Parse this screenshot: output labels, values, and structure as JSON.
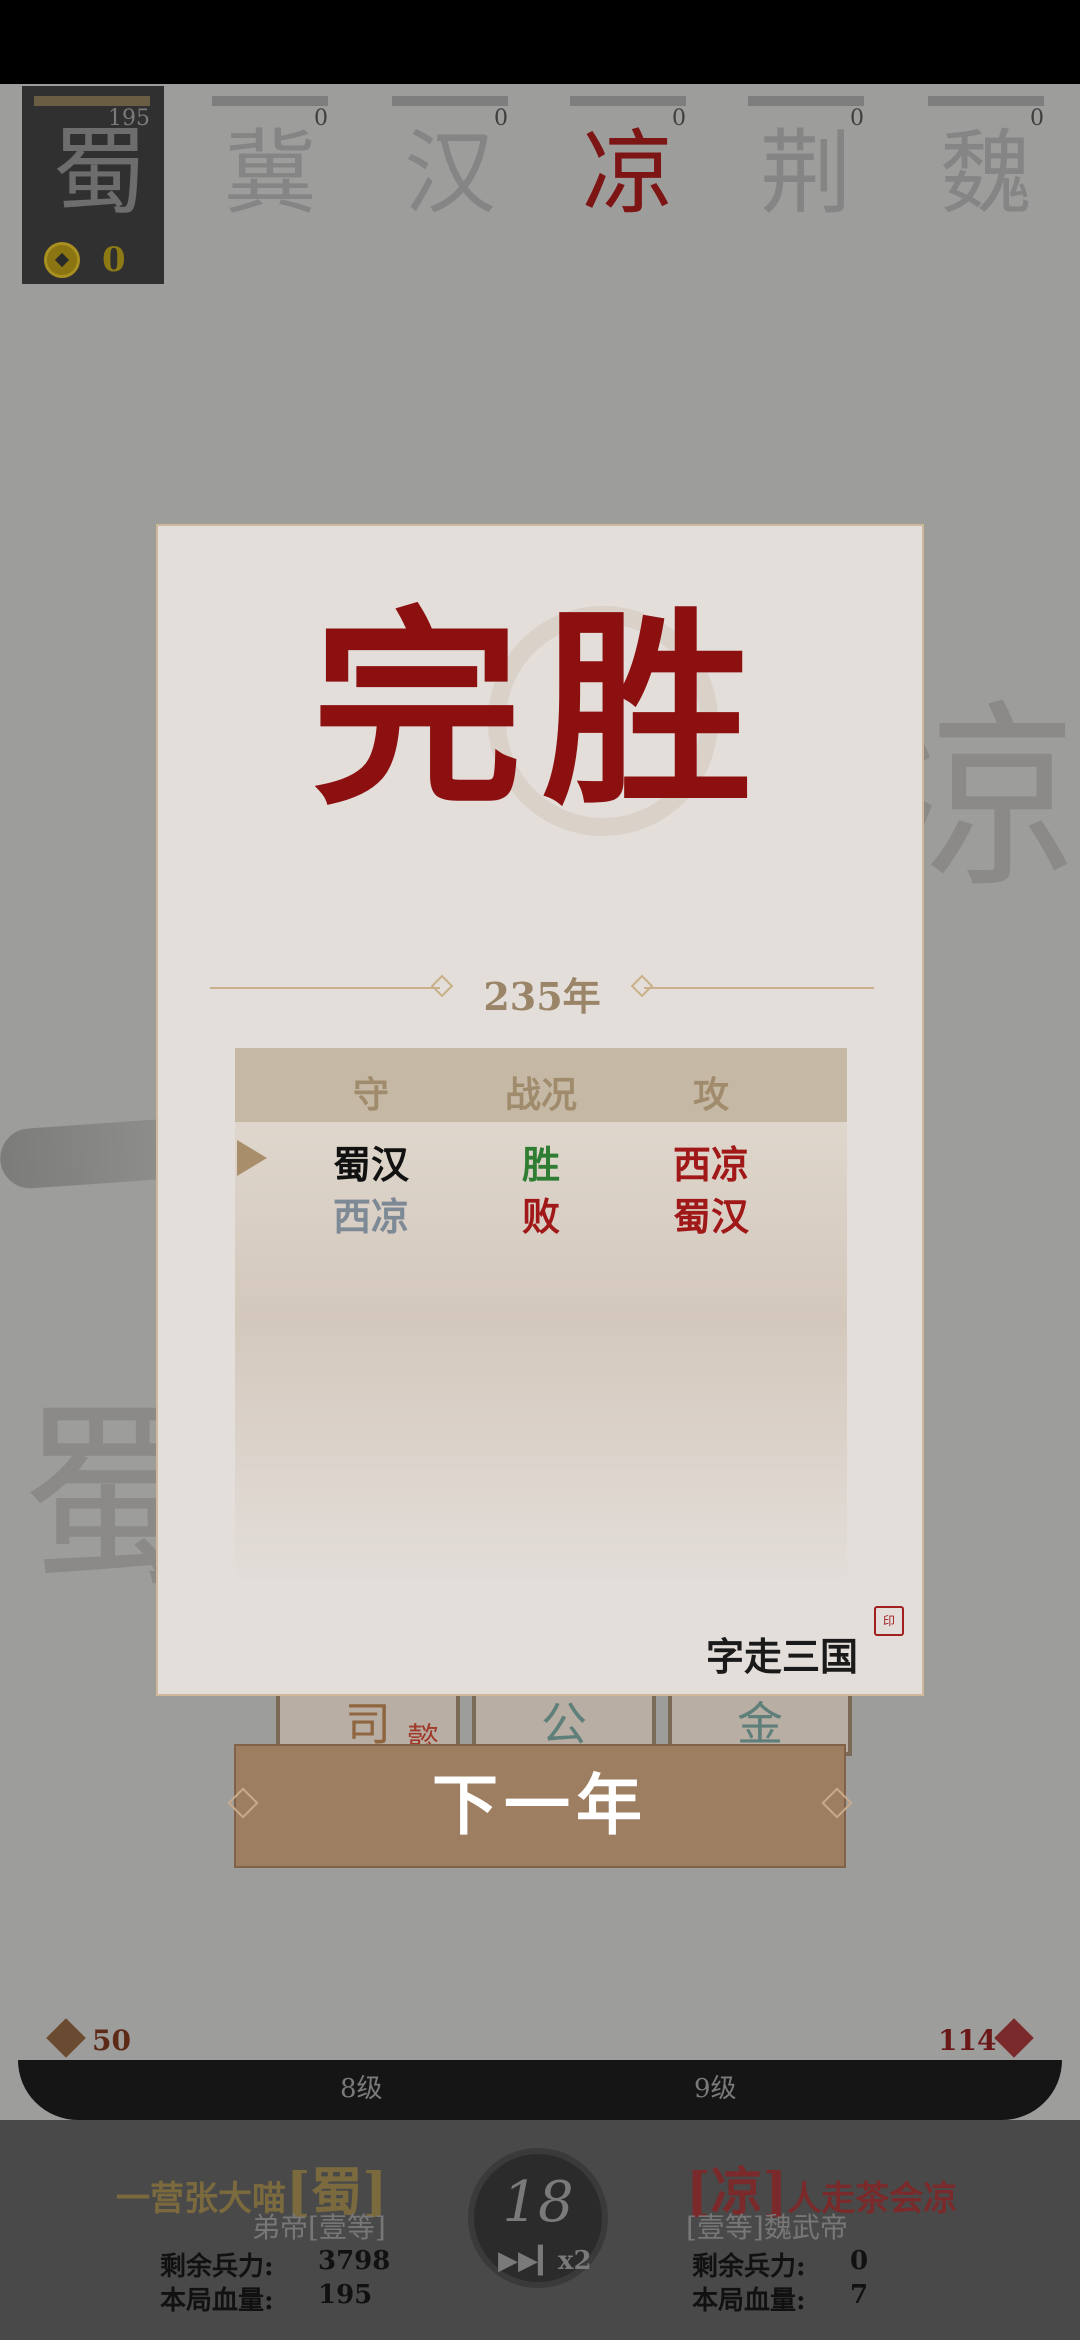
{
  "player": {
    "faction": "蜀",
    "score": "195",
    "coins": "0"
  },
  "factions": [
    {
      "name": "冀",
      "score": "0",
      "active": false
    },
    {
      "name": "汉",
      "score": "0",
      "active": false
    },
    {
      "name": "凉",
      "score": "0",
      "active": true
    },
    {
      "name": "荆",
      "score": "0",
      "active": false
    },
    {
      "name": "魏",
      "score": "0",
      "active": false
    }
  ],
  "background": {
    "right_char": "凉",
    "left_char": "蜀"
  },
  "dialog": {
    "title": "完胜",
    "year": "235年",
    "headers": [
      "守",
      "战况",
      "攻"
    ],
    "rows": [
      {
        "defender": "蜀汉",
        "result": "胜",
        "attacker": "西凉"
      },
      {
        "defender": "西凉",
        "result": "败",
        "attacker": "蜀汉"
      }
    ],
    "logo_text": "字走三国"
  },
  "behind_cards": [
    "司",
    "懿",
    "公",
    "金"
  ],
  "next_button": "下一年",
  "bottom": {
    "left_stat": "50",
    "right_stat": "114",
    "left_level": "8级",
    "right_level": "9级",
    "left_player": {
      "name": "一营张大喵",
      "faction": "[蜀]",
      "rank": "弟帝[壹等]",
      "troops_label": "剩余兵力:",
      "troops": "3798",
      "hp_label": "本局血量:",
      "hp": "195"
    },
    "right_player": {
      "name": "人走茶会凉",
      "faction": "[凉]",
      "rank": "[壹等]魏武帝",
      "troops_label": "剩余兵力:",
      "troops": "0",
      "hp_label": "本局血量:",
      "hp": "7"
    },
    "round": "18",
    "speed": "x2"
  },
  "colors": {
    "win": "#2e7d32",
    "lose": "#a01818",
    "accent": "#8c1010"
  }
}
